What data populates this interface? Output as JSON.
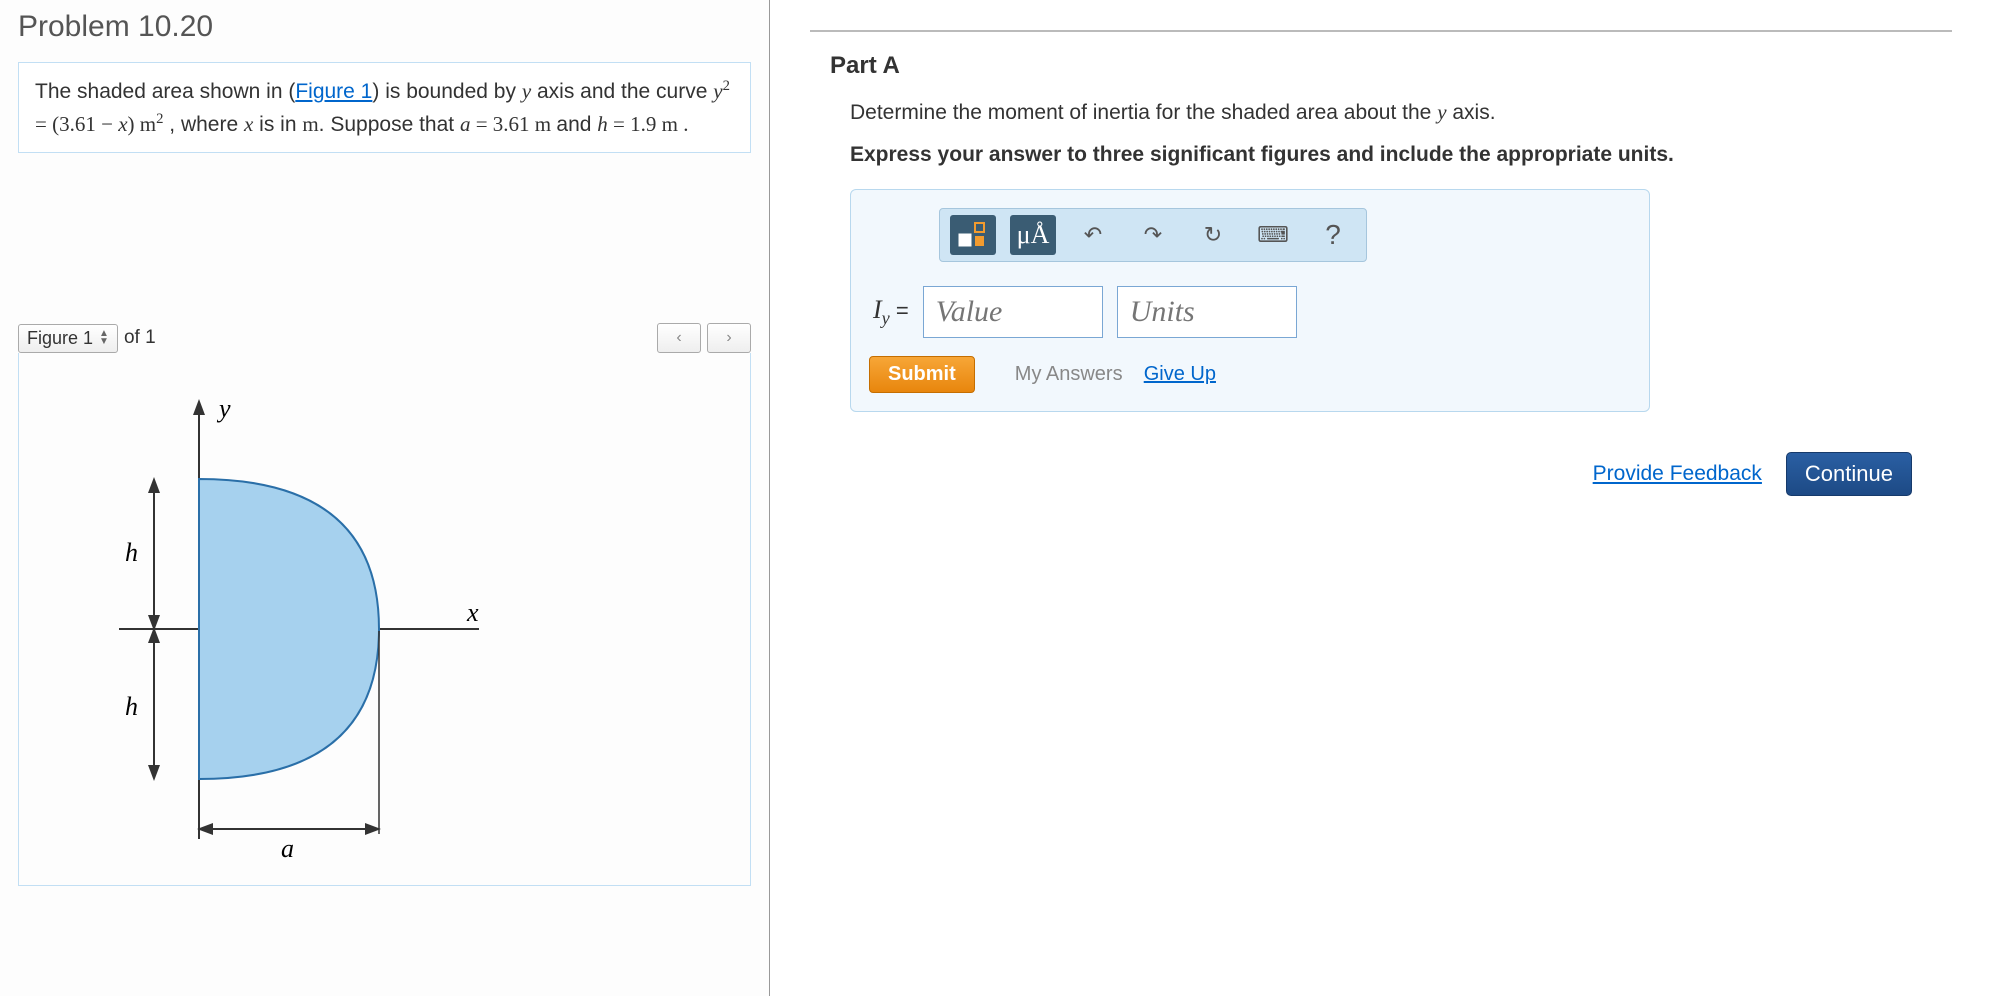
{
  "problem": {
    "title": "Problem 10.20",
    "statement_pre": "The shaded area shown in (",
    "figure_link": "Figure 1",
    "statement_mid": ") is bounded by ",
    "var_y": "y",
    "statement_axis": " axis and the curve ",
    "eq_lhs": "y",
    "eq_exp": "2",
    "eq_equals": " = (3.61 − ",
    "eq_x": "x",
    "eq_rhs": ") m",
    "eq_exp2": "2",
    "statement_where": " , where ",
    "var_x": "x",
    "statement_is": " is in ",
    "unit_m": "m",
    "statement_suppose": ". Suppose that ",
    "var_a": "a",
    "a_val": " = 3.61  m ",
    "statement_and": "and ",
    "var_h": "h",
    "h_val": " = 1.9  m ."
  },
  "figure_nav": {
    "current": "Figure 1",
    "of_text": "of 1",
    "prev": "‹",
    "next": "›"
  },
  "figure_labels": {
    "y": "y",
    "x": "x",
    "h": "h",
    "a": "a"
  },
  "partA": {
    "title": "Part A",
    "question_pre": "Determine the moment of inertia for the shaded area about the ",
    "question_var": "y",
    "question_post": " axis.",
    "instruction": "Express your answer to three significant figures and include the appropriate units.",
    "toolbar": {
      "templates": "▭▯",
      "symbols": "μÅ",
      "undo": "↶",
      "redo": "↷",
      "reset": "↻",
      "keyboard": "⌨",
      "help": "?"
    },
    "answer_label_I": "I",
    "answer_label_sub": "y",
    "answer_equals": " = ",
    "value_ph": "Value",
    "units_ph": "Units",
    "submit": "Submit",
    "my_answers": "My Answers",
    "give_up": "Give Up"
  },
  "footer": {
    "feedback": "Provide Feedback",
    "continue": "Continue"
  }
}
